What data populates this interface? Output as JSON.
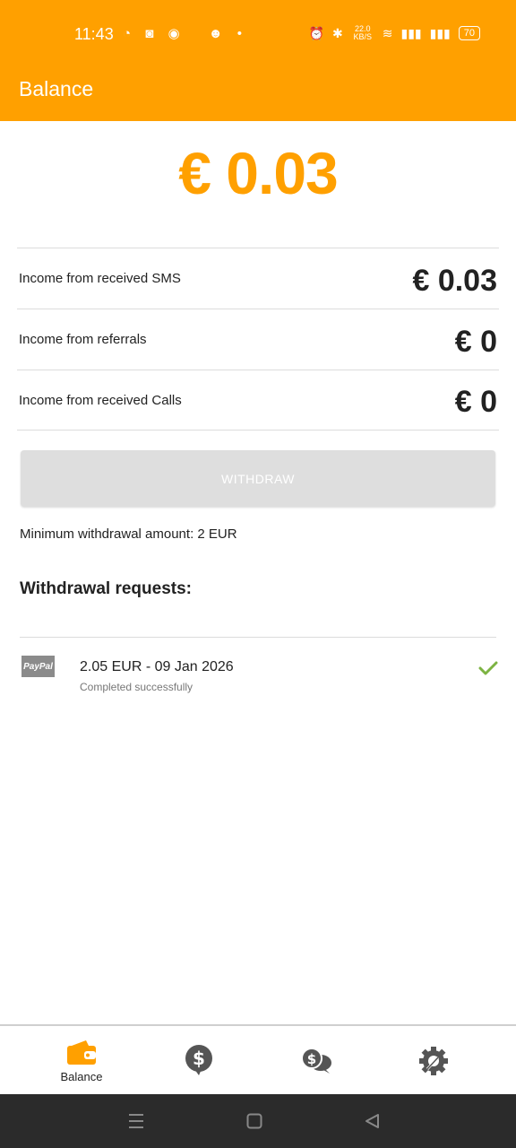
{
  "status_bar": {
    "time": "11:43",
    "network_speed": "22.0 KB/S",
    "battery": "70"
  },
  "app_bar": {
    "title": "Balance"
  },
  "balance": {
    "total": "€ 0.03"
  },
  "income": [
    {
      "label": "Income from received SMS",
      "value": "€ 0.03"
    },
    {
      "label": "Income from referrals",
      "value": "€ 0"
    },
    {
      "label": "Income from received Calls",
      "value": "€ 0"
    }
  ],
  "withdraw": {
    "button_label": "WITHDRAW",
    "minimum_text": "Minimum withdrawal amount: 2 EUR"
  },
  "requests": {
    "title": "Withdrawal requests:",
    "items": [
      {
        "method": "PayPal",
        "amount_date": "2.05 EUR - 09 Jan 2026",
        "status": "Completed successfully"
      }
    ]
  },
  "bottom_nav": {
    "items": [
      {
        "label": "Balance",
        "icon": "wallet-icon",
        "active": true
      },
      {
        "label": "",
        "icon": "dollar-chat-icon",
        "active": false
      },
      {
        "label": "",
        "icon": "chat-bubbles-icon",
        "active": false
      },
      {
        "label": "",
        "icon": "settings-gear-icon",
        "active": false
      }
    ]
  },
  "colors": {
    "accent": "#FFA000",
    "success": "#7CB342",
    "icon_gray": "#555555",
    "text_dark": "#222222"
  }
}
